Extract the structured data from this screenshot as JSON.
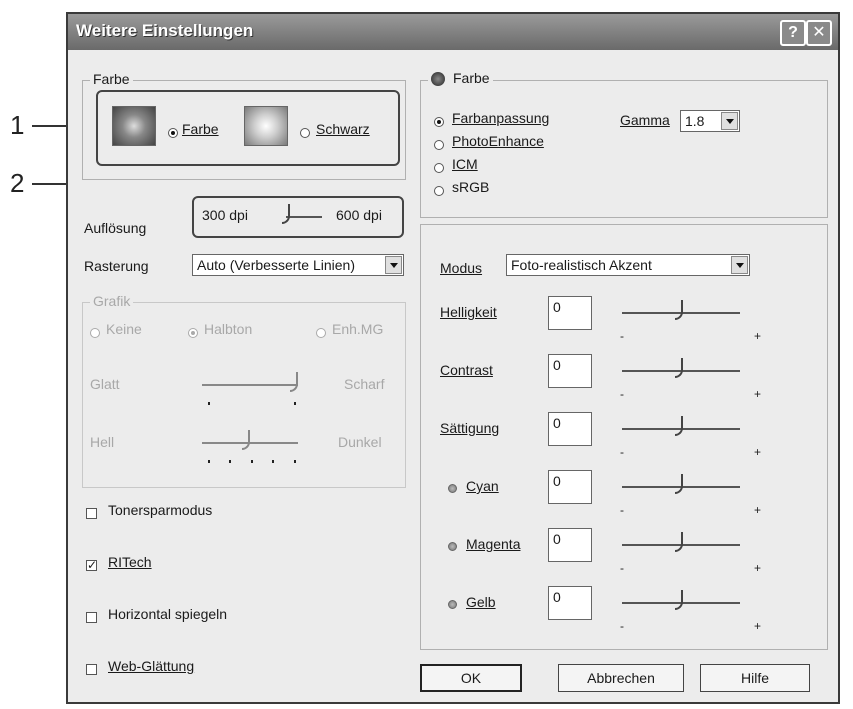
{
  "callouts": {
    "one": "1",
    "two": "2"
  },
  "window": {
    "title": "Weitere Einstellungen",
    "help_btn": "?",
    "close_btn": "✕"
  },
  "farbe_group": {
    "legend": "Farbe",
    "options": [
      {
        "label": "Farbe",
        "selected": true
      },
      {
        "label": "Schwarz",
        "selected": false
      }
    ]
  },
  "aufloesung": {
    "label": "Auflösung",
    "min": "300 dpi",
    "max": "600 dpi",
    "level": 0.0
  },
  "rasterung": {
    "label": "Rasterung",
    "value": "Auto (Verbesserte Linien)"
  },
  "grafik": {
    "legend": "Grafik",
    "options": [
      {
        "label": "Keine",
        "selected": false
      },
      {
        "label": "Halbton",
        "selected": true
      },
      {
        "label": "Enh.MG",
        "selected": false
      }
    ],
    "glatt_label": "Glatt",
    "scharf_label": "Scharf",
    "hell_label": "Hell",
    "dunkel_label": "Dunkel",
    "glatt_level": 1.0,
    "hell_level": 0.5
  },
  "checkboxes": [
    {
      "label": "Tonersparmodus",
      "checked": false
    },
    {
      "label": "RITech",
      "checked": true
    },
    {
      "label": "Horizontal spiegeln",
      "checked": false
    },
    {
      "label": "Web-Glättung",
      "checked": false
    }
  ],
  "color_group": {
    "legend": "Farbe",
    "options": [
      {
        "label": "Farbanpassung",
        "selected": true
      },
      {
        "label": "PhotoEnhance",
        "selected": false
      },
      {
        "label": "ICM",
        "selected": false
      },
      {
        "label": "sRGB",
        "selected": false
      }
    ],
    "gamma_label": "Gamma",
    "gamma_value": "1.8"
  },
  "adjust": {
    "modus_label": "Modus",
    "modus_value": "Foto-realistisch Akzent",
    "minus": "-",
    "plus": "+",
    "rows": [
      {
        "label": "Helligkeit",
        "value": "0",
        "level": 0.5
      },
      {
        "label": "Contrast",
        "value": "0",
        "level": 0.5
      },
      {
        "label": "Sättigung",
        "value": "0",
        "level": 0.5
      },
      {
        "label": "Cyan",
        "value": "0",
        "level": 0.5
      },
      {
        "label": "Magenta",
        "value": "0",
        "level": 0.5
      },
      {
        "label": "Gelb",
        "value": "0",
        "level": 0.5
      }
    ]
  },
  "buttons": {
    "ok": "OK",
    "cancel": "Abbrechen",
    "help": "Hilfe"
  }
}
